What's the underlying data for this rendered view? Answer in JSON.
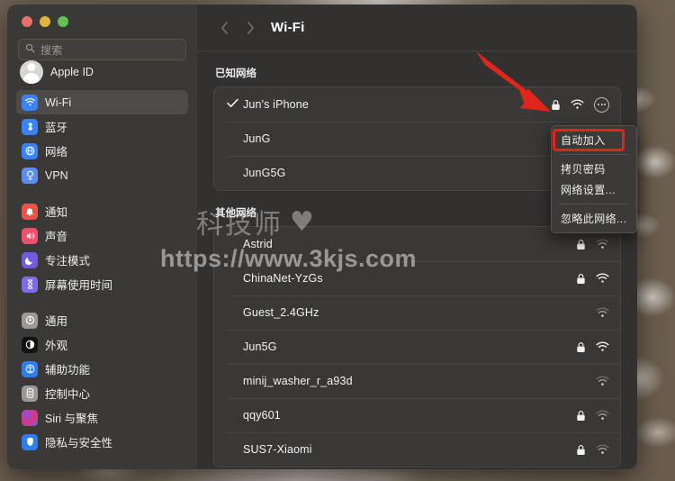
{
  "window": {
    "traffic_lights": [
      "close",
      "minimize",
      "zoom"
    ],
    "colors": {
      "red": "#e8706b",
      "yellow": "#e3b341",
      "green": "#62c254",
      "accent_highlight": "#e1251a",
      "selected_row": "#4d4b47"
    }
  },
  "sidebar": {
    "search": {
      "placeholder": "搜索",
      "value": ""
    },
    "account": {
      "label": "Apple ID"
    },
    "groups": [
      {
        "items": [
          {
            "label": "Wi-Fi",
            "icon": "wifi-icon",
            "selected": true
          },
          {
            "label": "蓝牙",
            "icon": "bluetooth-icon",
            "selected": false
          },
          {
            "label": "网络",
            "icon": "network-icon",
            "selected": false
          },
          {
            "label": "VPN",
            "icon": "vpn-icon",
            "selected": false
          }
        ]
      },
      {
        "items": [
          {
            "label": "通知",
            "icon": "notifications-icon",
            "selected": false
          },
          {
            "label": "声音",
            "icon": "sound-icon",
            "selected": false
          },
          {
            "label": "专注模式",
            "icon": "focus-moon-icon",
            "selected": false
          },
          {
            "label": "屏幕使用时间",
            "icon": "screen-time-hourglass-icon",
            "selected": false
          }
        ]
      },
      {
        "items": [
          {
            "label": "通用",
            "icon": "general-gear-icon",
            "selected": false
          },
          {
            "label": "外观",
            "icon": "appearance-icon",
            "selected": false
          },
          {
            "label": "辅助功能",
            "icon": "accessibility-icon",
            "selected": false
          },
          {
            "label": "控制中心",
            "icon": "control-center-icon",
            "selected": false
          },
          {
            "label": "Siri 与聚焦",
            "icon": "siri-icon",
            "selected": false
          },
          {
            "label": "隐私与安全性",
            "icon": "privacy-shield-icon",
            "selected": false
          }
        ]
      }
    ]
  },
  "toolbar": {
    "back_icon": "chevron-left-icon",
    "forward_icon": "chevron-right-icon",
    "title": "Wi-Fi"
  },
  "main": {
    "known_networks": {
      "section_label": "已知网络",
      "rows": [
        {
          "ssid": "Jun's iPhone",
          "connected": true,
          "secured": true,
          "signal": "wifi-full-icon",
          "has_more": true
        },
        {
          "ssid": "JunG",
          "connected": false,
          "secured": true,
          "signal": "wifi-full-icon",
          "has_more": false
        },
        {
          "ssid": "JunG5G",
          "connected": false,
          "secured": true,
          "signal": "wifi-full-icon",
          "has_more": false
        }
      ]
    },
    "other_networks": {
      "section_label": "其他网络",
      "rows": [
        {
          "ssid": "Astrid",
          "secured": true,
          "signal": "wifi-weak-icon"
        },
        {
          "ssid": "ChinaNet-YzGs",
          "secured": true,
          "signal": "wifi-full-icon"
        },
        {
          "ssid": "Guest_2.4GHz",
          "secured": false,
          "signal": "wifi-weak-icon"
        },
        {
          "ssid": "Jun5G",
          "secured": true,
          "signal": "wifi-full-icon"
        },
        {
          "ssid": "minij_washer_r_a93d",
          "secured": false,
          "signal": "wifi-weak-icon"
        },
        {
          "ssid": "qqy601",
          "secured": true,
          "signal": "wifi-weak-icon"
        },
        {
          "ssid": "SUS7-Xiaomi",
          "secured": true,
          "signal": "wifi-weak-icon"
        }
      ]
    }
  },
  "context_menu": {
    "items": [
      {
        "label": "自动加入",
        "highlighted": true
      },
      {
        "label": "拷贝密码",
        "highlighted": false
      },
      {
        "label": "网络设置...",
        "highlighted": false
      },
      {
        "label": "忽略此网络...",
        "highlighted": false
      }
    ]
  },
  "annotations": {
    "arrow": {
      "name": "red-arrow-pointer",
      "points_to": "more-options-button",
      "color": "#e1251a"
    },
    "highlight_box": {
      "name": "auto-join-highlight",
      "color": "#e1251a"
    }
  },
  "watermark": {
    "brand": "科技师",
    "heart": "♥",
    "url": "https://www.3kjs.com"
  }
}
